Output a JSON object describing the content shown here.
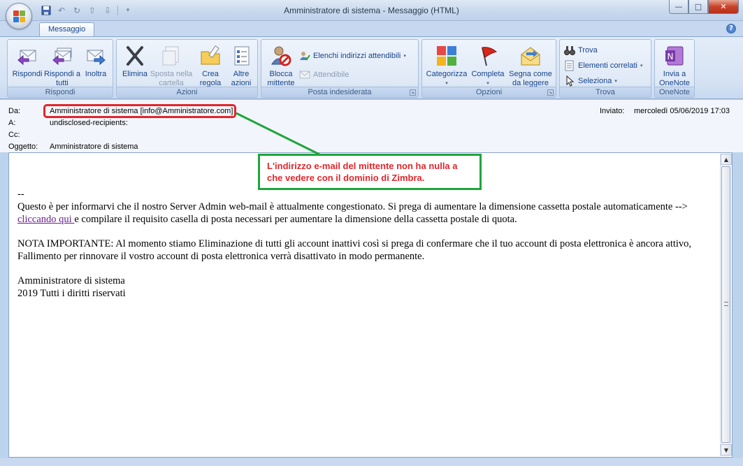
{
  "window": {
    "title": "Amministratore di sistema - Messaggio (HTML)",
    "minimize": "—",
    "maximize": "□",
    "close": "✕"
  },
  "ribbon": {
    "active_tab": "Messaggio",
    "help": "?",
    "groups": {
      "rispondi": {
        "label": "Rispondi",
        "buttons": [
          {
            "label": "Rispondi",
            "icon": "reply-icon"
          },
          {
            "label": "Rispondi a tutti",
            "icon": "reply-all-icon"
          },
          {
            "label": "Inoltra",
            "icon": "forward-icon"
          }
        ]
      },
      "azioni": {
        "label": "Azioni",
        "buttons": [
          {
            "label": "Elimina",
            "icon": "delete-icon"
          },
          {
            "label": "Sposta nella cartella",
            "icon": "move-icon"
          },
          {
            "label": "Crea regola",
            "icon": "rule-icon"
          },
          {
            "label": "Altre azioni",
            "icon": "other-actions-icon"
          }
        ]
      },
      "posta_indesiderata": {
        "label": "Posta indesiderata",
        "block": "Blocca mittente",
        "safe_lists": "Elenchi indirizzi attendibili",
        "not_junk": "Attendibile"
      },
      "opzioni": {
        "label": "Opzioni",
        "buttons": [
          {
            "label": "Categorizza",
            "icon": "categorize-icon"
          },
          {
            "label": "Completa",
            "icon": "follow-up-flag-icon"
          },
          {
            "label": "Segna come da leggere",
            "icon": "mark-unread-icon"
          }
        ]
      },
      "trova": {
        "label": "Trova",
        "find": "Trova",
        "related": "Elementi correlati",
        "select": "Seleziona"
      },
      "onenote": {
        "label": "OneNote",
        "button": "Invia a OneNote"
      }
    }
  },
  "header": {
    "from_label": "Da:",
    "from_value": "Amministratore di sistema [info@Amministratore.com]",
    "to_label": "A:",
    "to_value": "undisclosed-recipients:",
    "cc_label": "Cc:",
    "cc_value": "",
    "subject_label": "Oggetto:",
    "subject_value": "Amministratore di sistema",
    "sent_label": "Inviato:",
    "sent_value": "mercoledì 05/06/2019 17:03"
  },
  "message": {
    "separator": "--",
    "para1_before": "Questo è per informarvi che il nostro Server Admin web-mail è attualmente congestionato. Si prega di aumentare la dimensione cassetta postale automaticamente --> ",
    "link": "cliccando qui ",
    "para1_after": "e compilare il requisito casella di posta necessari per aumentare la dimensione della cassetta postale di quota.",
    "para2": "NOTA IMPORTANTE: Al momento stiamo Eliminazione di tutti gli account inattivi così si prega di confermare che il tuo account di posta elettronica è ancora attivo, Fallimento per rinnovare il vostro account di posta elettronica verrà disattivato in modo permanente.",
    "sig1": "Amministratore di sistema",
    "sig2": "2019 Tutti i diritti riservati"
  },
  "annotation": {
    "text": "L'indirizzo e-mail del mittente non ha nulla a che vedere con il dominio di Zimbra.",
    "color": "#e2262b",
    "border": "#1fa53c"
  }
}
